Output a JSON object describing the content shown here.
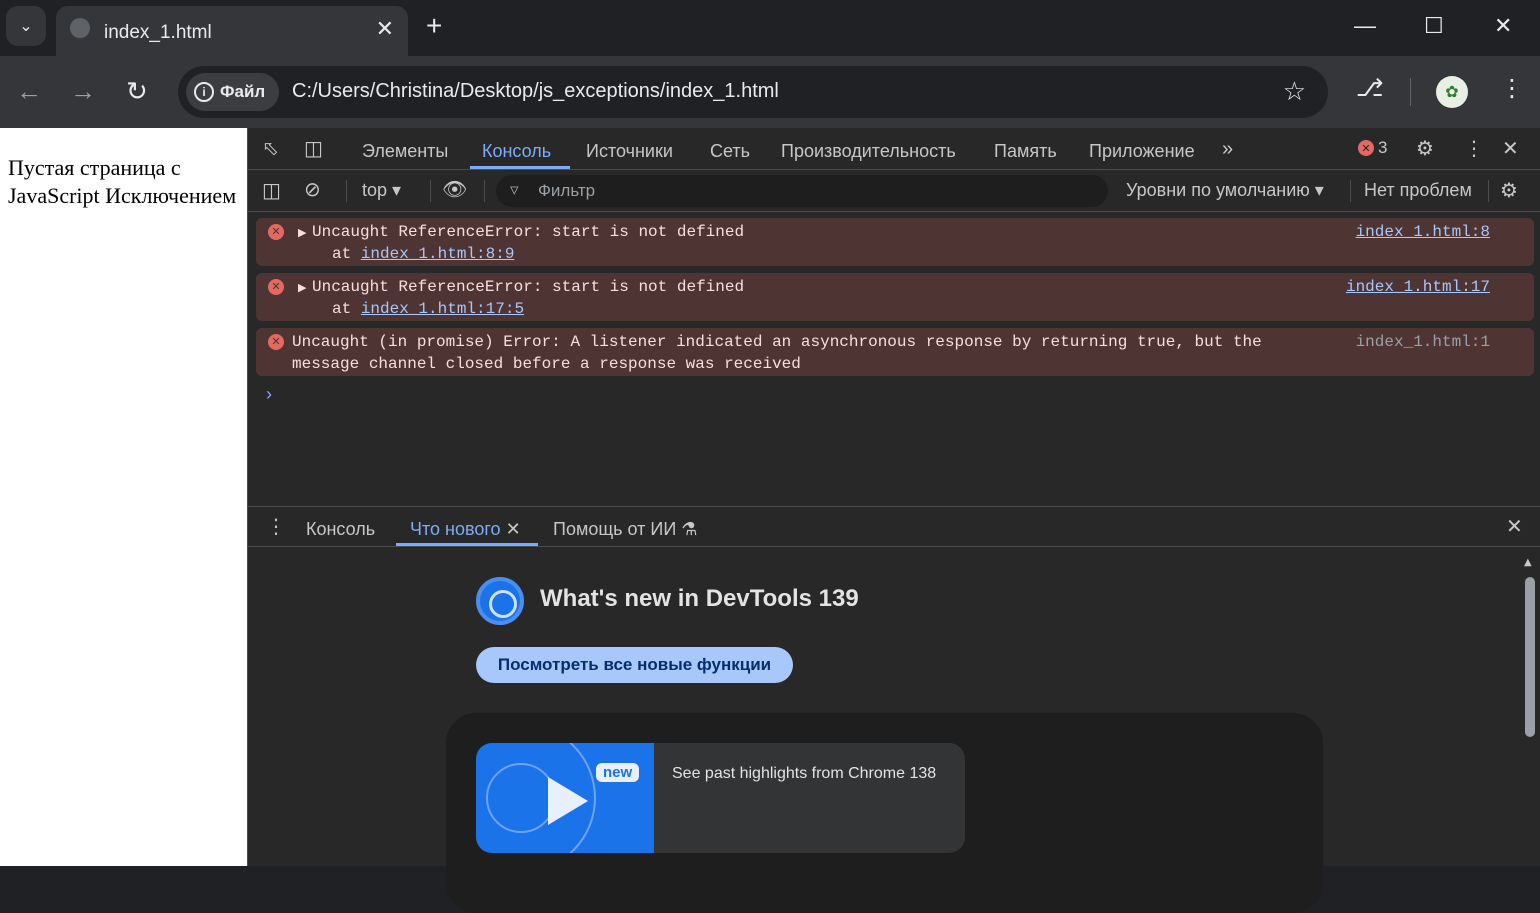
{
  "browser": {
    "tab_title": "index_1.html",
    "omnibox": {
      "security_chip": "Файл",
      "url": "C:/Users/Christina/Desktop/js_exceptions/index_1.html"
    }
  },
  "page": {
    "text": "Пустая страница с JavaScript Исключением"
  },
  "devtools": {
    "tabs": [
      "Элементы",
      "Консоль",
      "Источники",
      "Сеть",
      "Производительность",
      "Память",
      "Приложение"
    ],
    "error_count": "3",
    "filterbar": {
      "context": "top",
      "filter_placeholder": "Фильтр",
      "levels": "Уровни по умолчанию",
      "issues": "Нет проблем"
    },
    "messages": [
      {
        "text": "Uncaught ReferenceError: start is not defined",
        "at_prefix": "at ",
        "at_link": "index_1.html:8:9",
        "source": "index_1.html:8"
      },
      {
        "text": "Uncaught ReferenceError: start is not defined",
        "at_prefix": "at ",
        "at_link": "index_1.html:17:5",
        "source": "index_1.html:17"
      },
      {
        "text": "Uncaught (in promise) Error: A listener indicated an asynchronous response by returning true, but the message channel closed before a response was received",
        "source": "index_1.html:1"
      }
    ],
    "drawer": {
      "tabs": [
        "Консоль",
        "Что нового",
        "Помощь от ИИ"
      ],
      "whats_new_title": "What's new in DevTools 139",
      "see_all_button": "Посмотреть все новые функции",
      "card_badge": "new",
      "card_text": "See past highlights from Chrome 138"
    }
  },
  "colors": {
    "error_bg": "#4e3534",
    "accent": "#7cacf8",
    "link": "#a8c7fa"
  }
}
